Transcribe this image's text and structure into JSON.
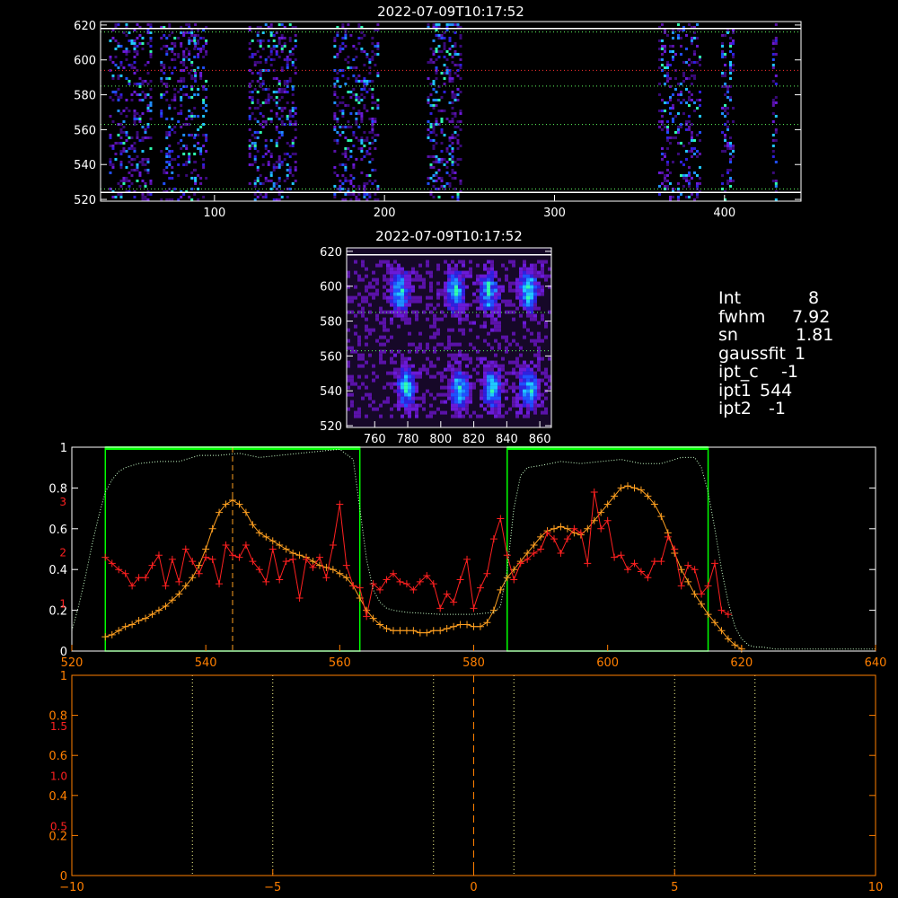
{
  "colors": {
    "background": "#000000",
    "axes": "#ffffff",
    "axes_orange": "#ff7f00",
    "profile_red": "#ff2020",
    "profile_orange": "#ffa020",
    "window_green": "#00ff00",
    "reference_dotted": "#c8ffc8",
    "yellow_dotted": "#ffff90"
  },
  "info": [
    {
      "key": "Int",
      "value": "8"
    },
    {
      "key": "fwhm",
      "value": "7.92"
    },
    {
      "key": "sn",
      "value": "1.81"
    },
    {
      "key": "gaussfit",
      "value": "1"
    },
    {
      "key": "ipt_c",
      "value": "-1"
    },
    {
      "key": "ipt1",
      "value": "544"
    },
    {
      "key": "ipt2",
      "value": "-1"
    }
  ],
  "chart_data": [
    {
      "type": "heatmap",
      "title": "2022-07-09T10:17:52",
      "xlim": [
        33,
        445
      ],
      "ylim": [
        519,
        622
      ],
      "x_ticks": [
        100,
        200,
        300,
        400
      ],
      "y_ticks": [
        520,
        540,
        560,
        580,
        600,
        620
      ],
      "hlines_solid": [
        524,
        618
      ],
      "hlines_dotted_green": [
        616,
        585,
        563,
        526
      ],
      "hlines_dotted_red": [
        594
      ],
      "bands": [
        [
          38,
          62
        ],
        [
          68,
          76
        ],
        [
          78,
          88
        ],
        [
          88,
          95
        ],
        [
          120,
          148
        ],
        [
          170,
          196
        ],
        [
          225,
          245
        ],
        [
          361,
          385
        ],
        [
          398,
          405
        ],
        [
          428,
          431
        ]
      ]
    },
    {
      "type": "heatmap",
      "title": "2022-07-09T10:17:52",
      "xlim": [
        743,
        867
      ],
      "ylim": [
        519,
        622
      ],
      "x_ticks": [
        760,
        780,
        800,
        820,
        840,
        860
      ],
      "y_ticks": [
        520,
        540,
        560,
        580,
        600,
        620
      ],
      "hlines_solid": [
        618
      ],
      "hlines_dotted_green": [
        585,
        563
      ],
      "blobs": [
        [
          774,
          598
        ],
        [
          808,
          598
        ],
        [
          828,
          598
        ],
        [
          852,
          598
        ],
        [
          778,
          542
        ],
        [
          810,
          542
        ],
        [
          830,
          542
        ],
        [
          852,
          542
        ]
      ]
    },
    {
      "type": "line",
      "xlim": [
        520,
        640
      ],
      "ylim": [
        0,
        1.0
      ],
      "x_ticks": [
        520,
        540,
        560,
        580,
        600,
        620,
        640
      ],
      "y_ticks": [
        0.0,
        0.2,
        0.4,
        0.6,
        0.8,
        1.0
      ],
      "y_ticks_right_red": [
        "1",
        "2",
        "3"
      ],
      "windows": [
        [
          525,
          563
        ],
        [
          585,
          615
        ]
      ],
      "vline_dashed": 544,
      "series": [
        {
          "style": "orange-plus",
          "x": [
            525,
            526,
            527,
            528,
            529,
            530,
            531,
            532,
            533,
            534,
            535,
            536,
            537,
            538,
            539,
            540,
            541,
            542,
            543,
            544,
            545,
            546,
            547,
            548,
            549,
            550,
            551,
            552,
            553,
            554,
            555,
            556,
            557,
            558,
            559,
            560,
            561,
            562,
            563,
            564,
            565,
            566,
            567,
            568,
            569,
            570,
            571,
            572,
            573,
            574,
            575,
            576,
            577,
            578,
            579,
            580,
            581,
            582,
            583,
            584,
            585,
            586,
            587,
            588,
            589,
            590,
            591,
            592,
            593,
            594,
            595,
            596,
            597,
            598,
            599,
            600,
            601,
            602,
            603,
            604,
            605,
            606,
            607,
            608,
            609,
            610,
            611,
            612,
            613,
            614,
            615,
            616,
            617,
            618,
            619,
            620
          ],
          "y": [
            0.07,
            0.08,
            0.1,
            0.12,
            0.13,
            0.15,
            0.16,
            0.18,
            0.2,
            0.22,
            0.25,
            0.28,
            0.32,
            0.36,
            0.42,
            0.5,
            0.6,
            0.68,
            0.72,
            0.74,
            0.72,
            0.68,
            0.62,
            0.58,
            0.56,
            0.54,
            0.52,
            0.5,
            0.48,
            0.47,
            0.46,
            0.44,
            0.42,
            0.41,
            0.4,
            0.38,
            0.36,
            0.32,
            0.26,
            0.2,
            0.16,
            0.13,
            0.11,
            0.1,
            0.1,
            0.1,
            0.1,
            0.09,
            0.09,
            0.1,
            0.1,
            0.11,
            0.12,
            0.13,
            0.13,
            0.12,
            0.12,
            0.14,
            0.2,
            0.3,
            0.36,
            0.4,
            0.44,
            0.48,
            0.52,
            0.56,
            0.59,
            0.6,
            0.61,
            0.6,
            0.58,
            0.57,
            0.6,
            0.64,
            0.68,
            0.72,
            0.76,
            0.8,
            0.81,
            0.8,
            0.79,
            0.76,
            0.72,
            0.66,
            0.58,
            0.48,
            0.4,
            0.34,
            0.28,
            0.23,
            0.18,
            0.14,
            0.1,
            0.06,
            0.03,
            0.01
          ]
        },
        {
          "style": "red-plus",
          "x": [
            525,
            526,
            527,
            528,
            529,
            530,
            531,
            532,
            533,
            534,
            535,
            536,
            537,
            538,
            539,
            540,
            541,
            542,
            543,
            544,
            545,
            546,
            547,
            548,
            549,
            550,
            551,
            552,
            553,
            554,
            555,
            556,
            557,
            558,
            559,
            560,
            561,
            562,
            563,
            564,
            565,
            566,
            567,
            568,
            569,
            570,
            571,
            572,
            573,
            574,
            575,
            576,
            577,
            578,
            579,
            580,
            581,
            582,
            583,
            584,
            585,
            586,
            587,
            588,
            589,
            590,
            591,
            592,
            593,
            594,
            595,
            596,
            597,
            598,
            599,
            600,
            601,
            602,
            603,
            604,
            605,
            606,
            607,
            608,
            609,
            610,
            611,
            612,
            613,
            614,
            615,
            616,
            617,
            618
          ],
          "y": [
            0.46,
            0.43,
            0.4,
            0.38,
            0.32,
            0.36,
            0.36,
            0.42,
            0.47,
            0.32,
            0.45,
            0.34,
            0.5,
            0.44,
            0.38,
            0.46,
            0.45,
            0.33,
            0.52,
            0.47,
            0.46,
            0.52,
            0.44,
            0.4,
            0.34,
            0.5,
            0.35,
            0.44,
            0.45,
            0.26,
            0.45,
            0.41,
            0.46,
            0.36,
            0.52,
            0.72,
            0.42,
            0.32,
            0.31,
            0.17,
            0.33,
            0.3,
            0.35,
            0.38,
            0.34,
            0.33,
            0.3,
            0.34,
            0.37,
            0.33,
            0.21,
            0.28,
            0.24,
            0.35,
            0.45,
            0.21,
            0.31,
            0.38,
            0.55,
            0.65,
            0.47,
            0.35,
            0.43,
            0.45,
            0.48,
            0.5,
            0.58,
            0.55,
            0.48,
            0.55,
            0.6,
            0.58,
            0.43,
            0.78,
            0.6,
            0.64,
            0.46,
            0.47,
            0.4,
            0.43,
            0.39,
            0.36,
            0.44,
            0.44,
            0.56,
            0.5,
            0.32,
            0.42,
            0.4,
            0.28,
            0.32,
            0.43,
            0.2,
            0.18
          ]
        },
        {
          "style": "dotted-reference",
          "x": [
            520,
            521,
            522,
            523,
            524,
            525,
            526,
            527,
            528,
            530,
            533,
            536,
            539,
            542,
            545,
            548,
            551,
            554,
            557,
            560,
            562,
            563,
            564,
            565,
            566,
            567,
            568,
            570,
            575,
            580,
            583,
            584,
            585,
            586,
            587,
            588,
            590,
            593,
            596,
            599,
            602,
            605,
            608,
            611,
            613,
            614,
            615,
            616,
            617,
            618,
            619,
            620,
            621,
            622,
            623,
            625,
            630,
            635,
            640
          ],
          "y": [
            0.1,
            0.22,
            0.36,
            0.52,
            0.66,
            0.78,
            0.84,
            0.88,
            0.9,
            0.92,
            0.93,
            0.93,
            0.96,
            0.96,
            0.97,
            0.95,
            0.96,
            0.97,
            0.98,
            0.99,
            0.94,
            0.7,
            0.45,
            0.3,
            0.24,
            0.21,
            0.2,
            0.19,
            0.18,
            0.18,
            0.19,
            0.22,
            0.4,
            0.7,
            0.86,
            0.9,
            0.91,
            0.93,
            0.92,
            0.93,
            0.94,
            0.92,
            0.92,
            0.95,
            0.95,
            0.9,
            0.78,
            0.6,
            0.4,
            0.24,
            0.12,
            0.06,
            0.03,
            0.02,
            0.02,
            0.01,
            0.01,
            0.01,
            0.01
          ]
        }
      ]
    },
    {
      "type": "line",
      "xlim": [
        -10,
        10
      ],
      "ylim": [
        0,
        1.0
      ],
      "x_ticks": [
        -10,
        -5,
        0,
        5,
        10
      ],
      "y_ticks": [
        0.0,
        0.2,
        0.4,
        0.6,
        0.8,
        1.0
      ],
      "y_ticks_red_labels": [
        "0.5",
        "1.0",
        "1.5"
      ],
      "y_ticks_red_values": [
        0.25,
        0.5,
        0.75
      ],
      "vlines_dotted": [
        -7,
        -5,
        -1,
        1,
        5,
        7
      ],
      "vline_dashed": 0
    }
  ]
}
